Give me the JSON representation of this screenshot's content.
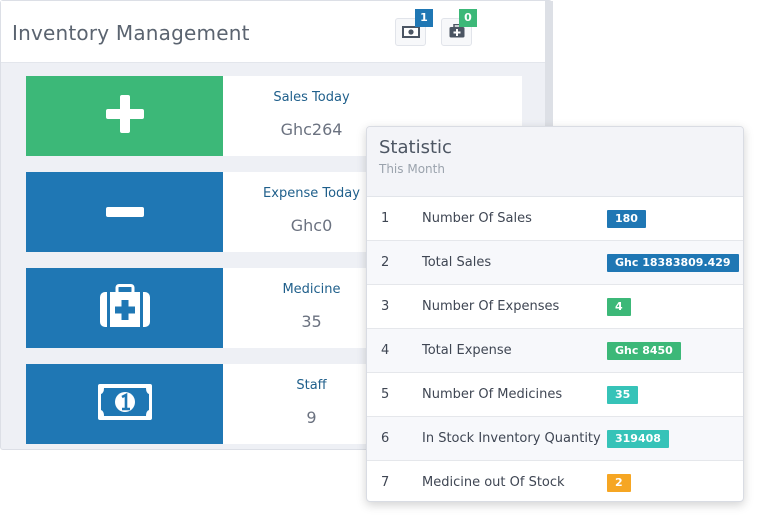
{
  "header": {
    "title": "Inventory Management",
    "cash_count": "1",
    "medkit_count": "0"
  },
  "colors": {
    "green": "#3cb878",
    "blue": "#1f77b4",
    "teal": "#36c3b8",
    "orange": "#f6a623"
  },
  "cards": [
    {
      "label": "Sales Today",
      "value": "Ghc264",
      "icon": "plus-icon",
      "color": "#3cb878"
    },
    {
      "label": "Expense Today",
      "value": "Ghc0",
      "icon": "minus-icon",
      "color": "#1f77b4"
    },
    {
      "label": "Medicine",
      "value": "35",
      "icon": "medkit-icon",
      "color": "#1f77b4"
    },
    {
      "label": "Staff",
      "value": "9",
      "icon": "money-icon",
      "color": "#1f77b4"
    }
  ],
  "statistic": {
    "title": "Statistic",
    "subtitle": "This Month",
    "rows": [
      {
        "num": "1",
        "name": "Number Of Sales",
        "value": "180",
        "color": "#1f77b4"
      },
      {
        "num": "2",
        "name": "Total Sales",
        "value": "Ghc 18383809.429",
        "color": "#1f77b4"
      },
      {
        "num": "3",
        "name": "Number Of Expenses",
        "value": "4",
        "color": "#3cb878"
      },
      {
        "num": "4",
        "name": "Total Expense",
        "value": "Ghc 8450",
        "color": "#3cb878"
      },
      {
        "num": "5",
        "name": "Number Of Medicines",
        "value": "35",
        "color": "#36c3b8"
      },
      {
        "num": "6",
        "name": "In Stock Inventory Quantity",
        "value": "319408",
        "color": "#36c3b8"
      },
      {
        "num": "7",
        "name": "Medicine out Of Stock",
        "value": "2",
        "color": "#f6a623"
      }
    ]
  }
}
